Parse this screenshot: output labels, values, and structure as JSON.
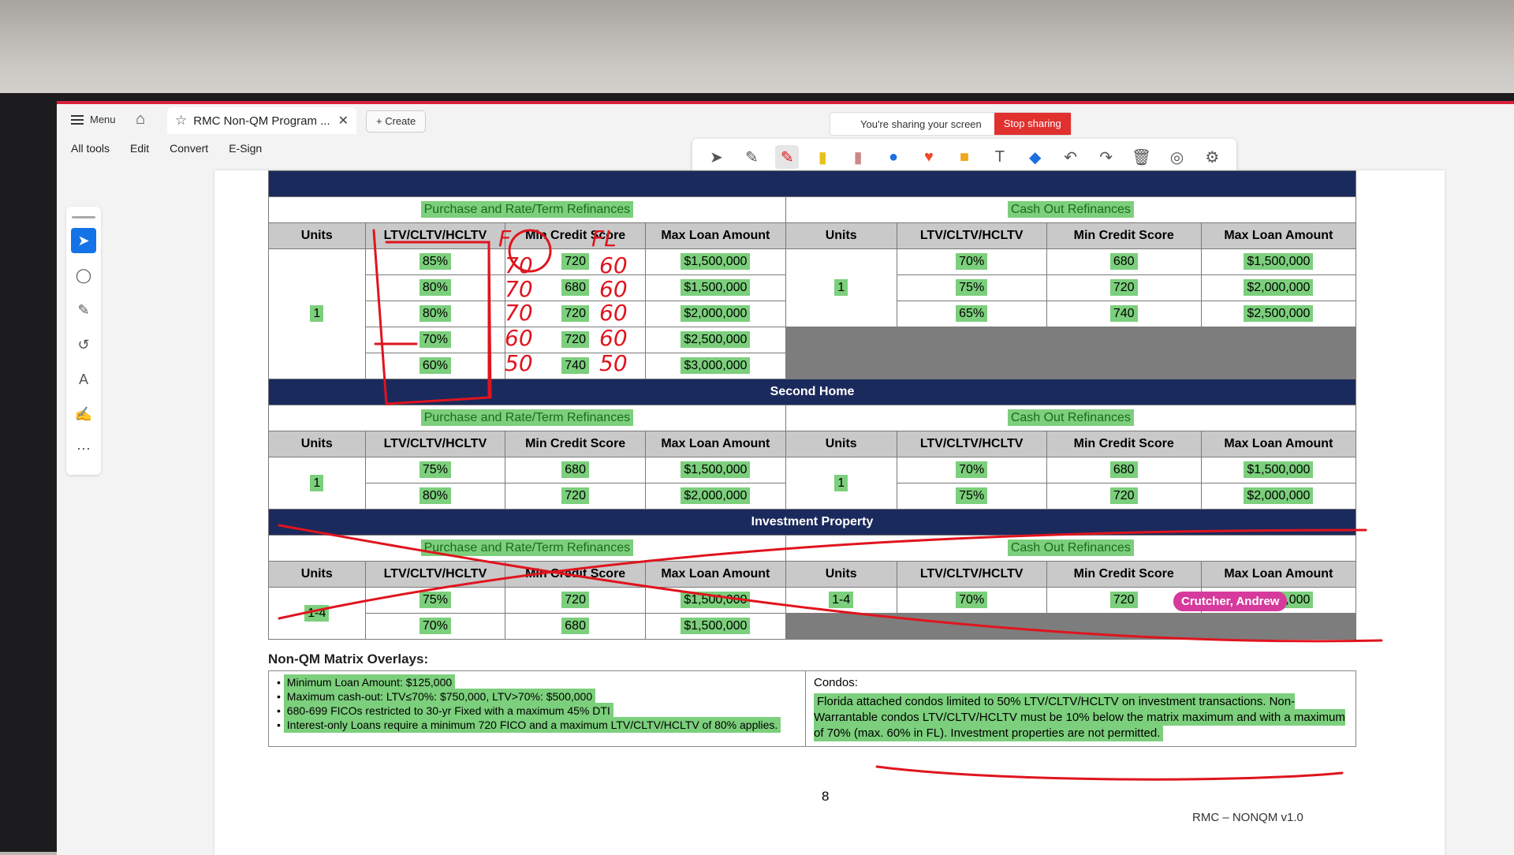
{
  "topbar": {
    "menu_label": "Menu",
    "tab_title": "RMC Non-QM Program ...",
    "create_label": "Create",
    "sharing_text": "You're sharing your screen",
    "stop_sharing_label": "Stop sharing"
  },
  "menubar": [
    "All tools",
    "Edit",
    "Convert",
    "E-Sign"
  ],
  "sections": {
    "primary": {
      "left_title": "Purchase and Rate/Term Refinances",
      "right_title": "Cash Out Refinances",
      "headers": [
        "Units",
        "LTV/CLTV/HCLTV",
        "Min Credit Score",
        "Max Loan Amount"
      ],
      "left_units": "1",
      "left_rows": [
        [
          "85%",
          "720",
          "$1,500,000"
        ],
        [
          "80%",
          "680",
          "$1,500,000"
        ],
        [
          "80%",
          "720",
          "$2,000,000"
        ],
        [
          "70%",
          "720",
          "$2,500,000"
        ],
        [
          "60%",
          "740",
          "$3,000,000"
        ]
      ],
      "right_units": "1",
      "right_rows": [
        [
          "70%",
          "680",
          "$1,500,000"
        ],
        [
          "75%",
          "720",
          "$2,000,000"
        ],
        [
          "65%",
          "740",
          "$2,500,000"
        ]
      ]
    },
    "second_home": {
      "banner": "Second Home",
      "left_title": "Purchase and Rate/Term Refinances",
      "right_title": "Cash Out Refinances",
      "left_units": "1",
      "left_rows": [
        [
          "75%",
          "680",
          "$1,500,000"
        ],
        [
          "80%",
          "720",
          "$2,000,000"
        ]
      ],
      "right_units": "1",
      "right_rows": [
        [
          "70%",
          "680",
          "$1,500,000"
        ],
        [
          "75%",
          "720",
          "$2,000,000"
        ]
      ]
    },
    "investment": {
      "banner": "Investment Property",
      "left_title": "Purchase and Rate/Term Refinances",
      "right_title": "Cash Out Refinances",
      "left_units": "1-4",
      "left_rows": [
        [
          "75%",
          "720",
          "$1,500,000"
        ],
        [
          "70%",
          "680",
          "$1,500,000"
        ]
      ],
      "right_units": "1-4",
      "right_rows": [
        [
          "70%",
          "720",
          "$1,500,000"
        ]
      ]
    }
  },
  "overlays": {
    "title": "Non-QM Matrix Overlays:",
    "items": [
      "Minimum Loan Amount: $125,000",
      "Maximum cash-out: LTV≤70%: $750,000, LTV>70%: $500,000",
      "680-699 FICOs restricted to 30-yr Fixed with a maximum 45% DTI",
      "Interest-only Loans require a minimum 720 FICO and a maximum LTV/CLTV/HCLTV of 80% applies."
    ],
    "condos_title": "Condos:",
    "condos_text": "Florida attached condos limited to 50% LTV/CLTV/HCLTV on investment transactions. Non-Warrantable condos LTV/CLTV/HCLTV must be 10% below the matrix maximum and with a maximum of 70% (max. 60% in FL). Investment properties are not permitted."
  },
  "page_number": "8",
  "footer": "RMC – NONQM v1.0",
  "cursor_name": "Crutcher, Andrew",
  "handwriting": [
    "F",
    "FL",
    "70",
    "70",
    "70",
    "60",
    "50",
    "60",
    "60",
    "60",
    "60",
    "50"
  ],
  "colors": {
    "ink": "#e0141e",
    "highlight": "#7ccf7c",
    "navy": "#1b2a5c",
    "stop": "#e0312f",
    "cursor": "#d63a9c"
  }
}
